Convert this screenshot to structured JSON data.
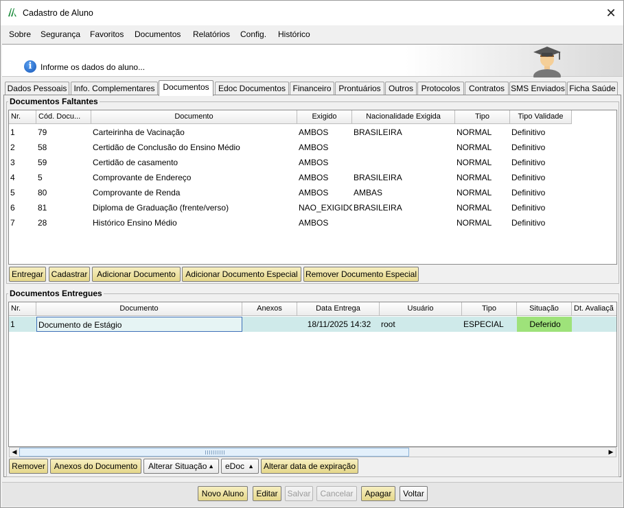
{
  "window": {
    "title": "Cadastro de Aluno"
  },
  "menu": [
    "Sobre",
    "Segurança",
    "Favoritos",
    "Documentos",
    "Relatórios",
    "Config.",
    "Histórico"
  ],
  "info": {
    "message": "Informe os dados do aluno..."
  },
  "tabs": [
    "Dados Pessoais",
    "Info. Complementares",
    "Documentos",
    "Edoc Documentos",
    "Financeiro",
    "Prontuários",
    "Outros",
    "Protocolos",
    "Contratos",
    "SMS Enviados",
    "Ficha Saúde"
  ],
  "active_tab": "Documentos",
  "faltantes": {
    "title": "Documentos Faltantes",
    "columns": [
      "Nr.",
      "Cód. Docu...",
      "Documento",
      "Exigido",
      "Nacionalidade Exigida",
      "Tipo",
      "Tipo Validade"
    ],
    "rows": [
      [
        "1",
        "79",
        "Carteirinha de Vacinação",
        "AMBOS",
        "BRASILEIRA",
        "NORMAL",
        "Definitivo"
      ],
      [
        "2",
        "58",
        "Certidão de Conclusão do Ensino Médio",
        "AMBOS",
        "",
        "NORMAL",
        "Definitivo"
      ],
      [
        "3",
        "59",
        "Certidão de casamento",
        "AMBOS",
        "",
        "NORMAL",
        "Definitivo"
      ],
      [
        "4",
        "5",
        "Comprovante de Endereço",
        "AMBOS",
        "BRASILEIRA",
        "NORMAL",
        "Definitivo"
      ],
      [
        "5",
        "80",
        "Comprovante de Renda",
        "AMBOS",
        "AMBAS",
        "NORMAL",
        "Definitivo"
      ],
      [
        "6",
        "81",
        "Diploma de Graduação (frente/verso)",
        "NAO_EXIGIDO",
        "BRASILEIRA",
        "NORMAL",
        "Definitivo"
      ],
      [
        "7",
        "28",
        "Histórico Ensino Médio",
        "AMBOS",
        "",
        "NORMAL",
        "Definitivo"
      ]
    ],
    "buttons": [
      "Entregar",
      "Cadastrar",
      "Adicionar Documento",
      "Adicionar Documento Especial",
      "Remover Documento Especial"
    ]
  },
  "entregues": {
    "title": "Documentos Entregues",
    "columns": [
      "Nr.",
      "Documento",
      "Anexos",
      "Data Entrega",
      "Usuário",
      "Tipo",
      "Situação",
      "Dt. Avaliaçã"
    ],
    "rows": [
      [
        "1",
        "Documento de Estágio",
        "",
        "18/11/2025 14:32",
        "root",
        "ESPECIAL",
        "Deferido",
        ""
      ]
    ],
    "buttons": [
      "Remover",
      "Anexos do Documento",
      "Alterar Situação",
      "eDoc",
      "Alterar data de expiração"
    ]
  },
  "footer_buttons": [
    "Novo Aluno",
    "Editar",
    "Salvar",
    "Cancelar",
    "Apagar",
    "Voltar"
  ],
  "colors": {
    "selected_row": "#cfeaea",
    "deferido": "#9ee27a",
    "button_bg": "#f1e6a8"
  }
}
